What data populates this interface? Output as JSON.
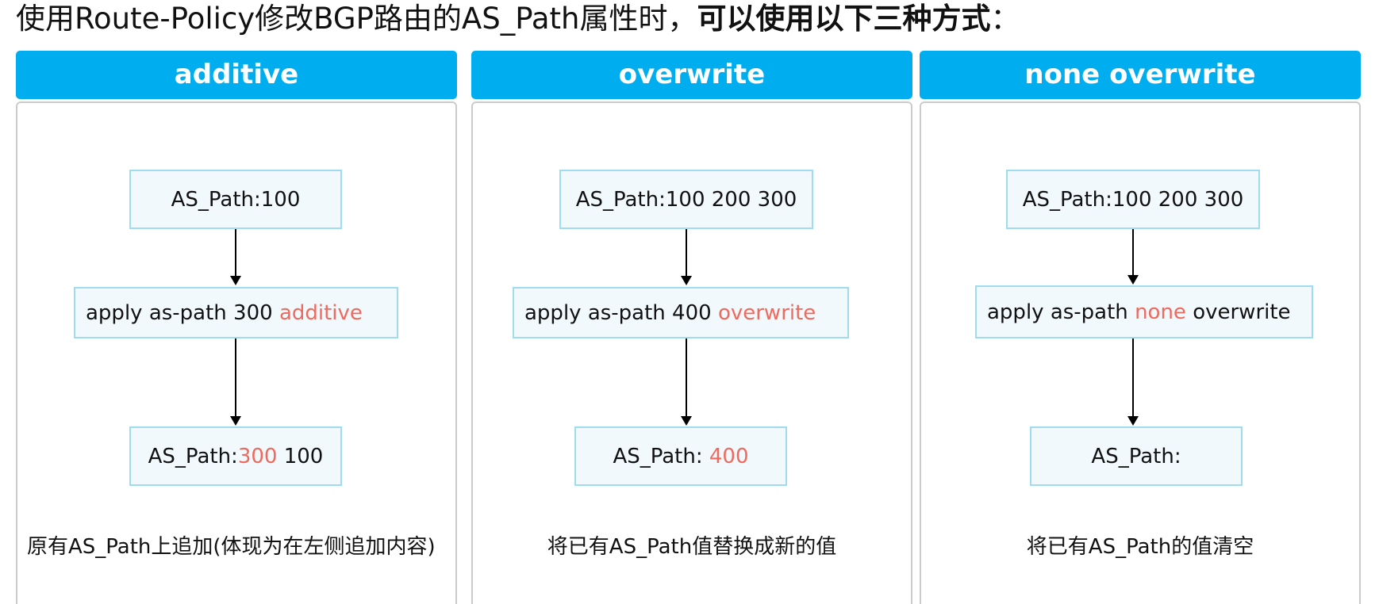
{
  "title": {
    "normal": "使用Route-Policy修改BGP路由的AS_Path属性时，",
    "bold": "可以使用以下三种方式",
    "colon": "："
  },
  "panels": [
    {
      "header": "additive",
      "input_box": "AS_Path:100",
      "apply_box": {
        "prefix": "apply as-path 300 ",
        "keyword": "additive",
        "suffix": ""
      },
      "result_box": {
        "prefix": "AS_Path:",
        "highlight": "300",
        "suffix": " 100"
      },
      "caption": "原有AS_Path上追加(体现为在左侧追加内容)"
    },
    {
      "header": "overwrite",
      "input_box": "AS_Path:100 200 300",
      "apply_box": {
        "prefix": "apply as-path 400 ",
        "keyword": "overwrite",
        "suffix": ""
      },
      "result_box": {
        "prefix": "AS_Path: ",
        "highlight": "400",
        "suffix": ""
      },
      "caption": "将已有AS_Path值替换成新的值"
    },
    {
      "header": "none overwrite",
      "input_box": "AS_Path:100 200 300",
      "apply_box": {
        "prefix": "apply as-path ",
        "keyword": "none",
        "suffix": " overwrite"
      },
      "result_box": {
        "prefix": "AS_Path:",
        "highlight": "",
        "suffix": ""
      },
      "caption": "将已有AS_Path的值清空"
    }
  ],
  "colors": {
    "header_bg": "#00aeef",
    "header_text": "#ffffff",
    "box_bg": "#f2f9fc",
    "box_border": "#9fdcf0",
    "highlight": "#ee6a5e",
    "panel_border": "#cbcbcb"
  }
}
